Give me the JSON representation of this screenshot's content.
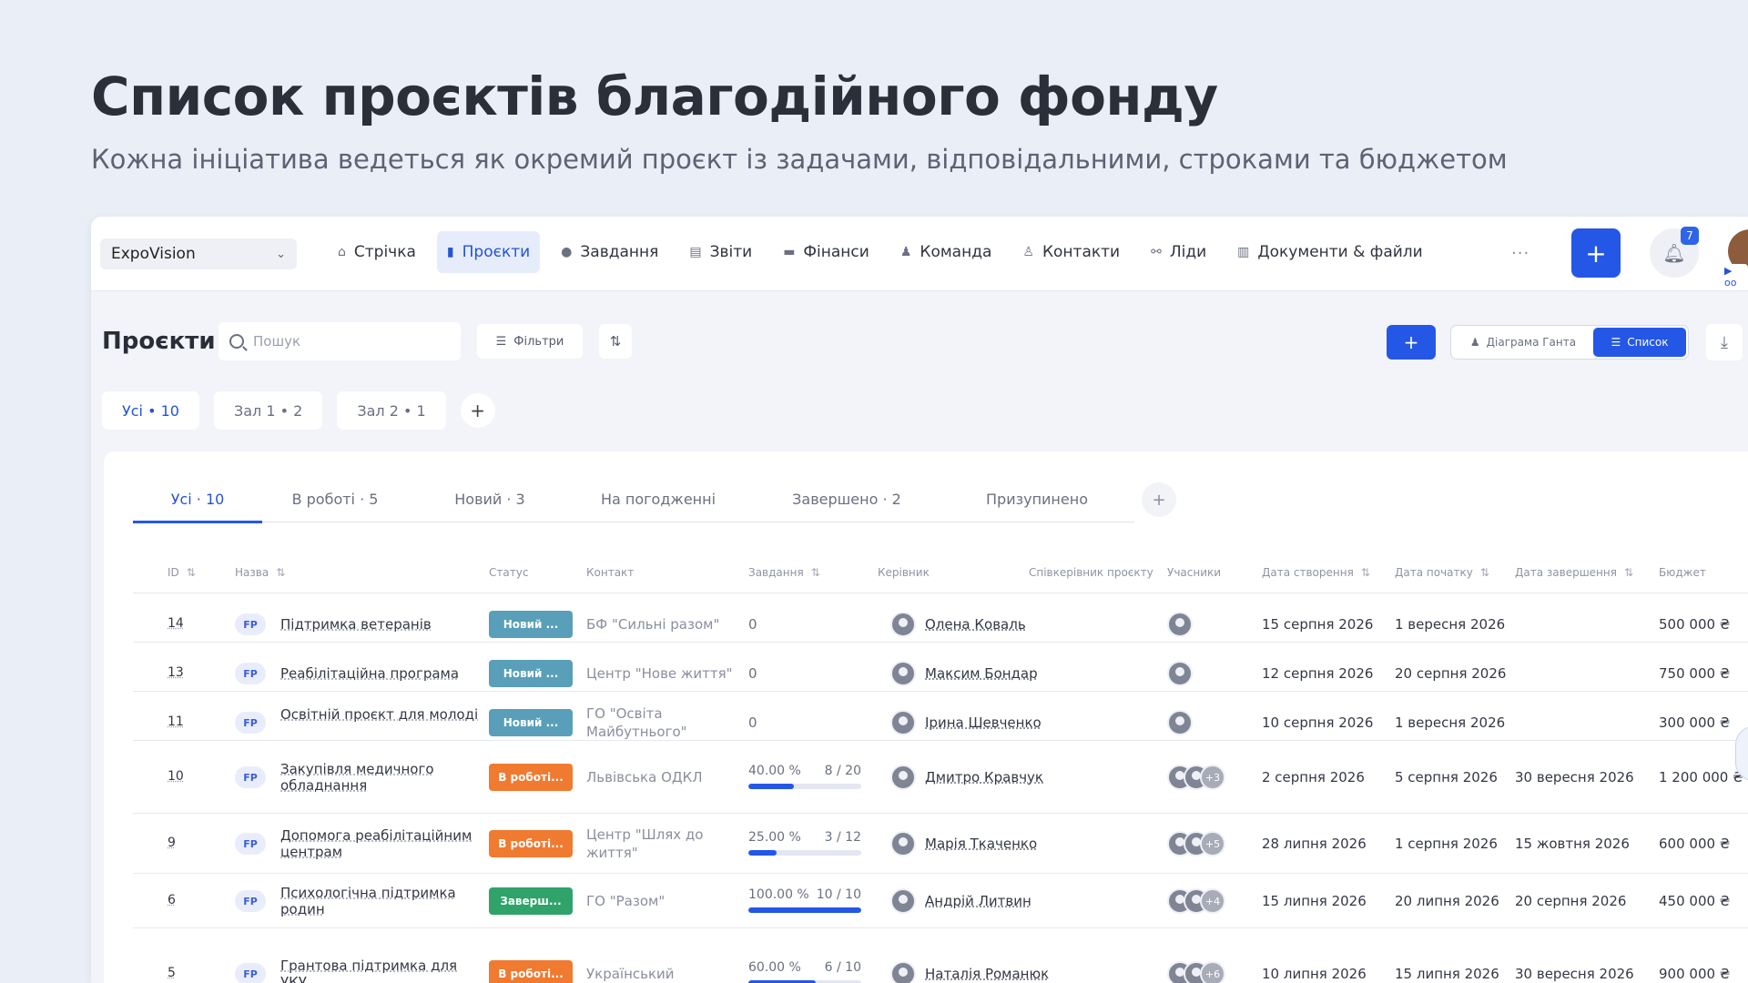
{
  "hero": {
    "title": "Список проєктів благодійного фонду",
    "subtitle": "Кожна ініціатива ведеться як окремий проєкт із задачами, відповідальними, строками та бюджетом"
  },
  "topnav": {
    "org": "ExpoVision",
    "items": [
      {
        "label": "Стрічка",
        "icon": "home-icon"
      },
      {
        "label": "Проєкти",
        "icon": "file-icon",
        "active": true
      },
      {
        "label": "Завдання",
        "icon": "check-circle-icon"
      },
      {
        "label": "Звіти",
        "icon": "report-icon"
      },
      {
        "label": "Фінанси",
        "icon": "wallet-icon"
      },
      {
        "label": "Команда",
        "icon": "user-icon"
      },
      {
        "label": "Контакти",
        "icon": "contacts-icon"
      },
      {
        "label": "Ліди",
        "icon": "leads-icon"
      },
      {
        "label": "Документи & файли",
        "icon": "book-icon"
      }
    ],
    "more": "···",
    "add": "+",
    "notifications": "7",
    "avatar_tag": "▶ oo"
  },
  "toolbar": {
    "title": "Проєкти",
    "search_placeholder": "Пошук",
    "filters": "Фільтри",
    "add": "+",
    "view_gantt": "Діаграма Ганта",
    "view_list": "Список"
  },
  "halls": [
    "Усі • 10",
    "Зал 1 • 2",
    "Зал 2 • 1"
  ],
  "status_tabs": [
    "Усі · 10",
    "В роботі · 5",
    "Новий · 3",
    "На погодженні",
    "Завершено · 2",
    "Призупинено"
  ],
  "table": {
    "headers": {
      "id": "ID",
      "name": "Назва",
      "status": "Статус",
      "contact": "Контакт",
      "tasks": "Завдання",
      "lead": "Керівник",
      "colead": "Співкерівник проєкту",
      "members": "Учасники",
      "created": "Дата створення",
      "start": "Дата початку",
      "end": "Дата завершення",
      "budget": "Бюджет"
    },
    "rows": [
      {
        "id": "14",
        "tag": "FP",
        "name": "Підтримка ветеранів",
        "status": "Новий ...",
        "contact": "БФ \"Сильні разом\"",
        "tasks": "0",
        "lead": "Олена Коваль",
        "created": "15 серпня 2026",
        "start": "1 вересня 2026",
        "end": "",
        "budget": "500 000 ₴"
      },
      {
        "id": "13",
        "tag": "FP",
        "name": "Реабілітаційна програма",
        "status": "Новий ...",
        "contact": "Центр \"Нове життя\"",
        "tasks": "0",
        "lead": "Максим Бондар",
        "created": "12 серпня 2026",
        "start": "20 серпня 2026",
        "end": "",
        "budget": "750 000 ₴"
      },
      {
        "id": "11",
        "tag": "FP",
        "name": "Освітній проєкт для молоді",
        "status": "Новий ...",
        "contact": "ГО \"Освіта Майбутнього\"",
        "tasks": "0",
        "lead": "Ірина Шевченко",
        "created": "10 серпня 2026",
        "start": "1 вересня 2026",
        "end": "",
        "budget": "300 000 ₴"
      },
      {
        "id": "10",
        "tag": "FP",
        "name": "Закупівля медичного обладнання",
        "status": "В роботі...",
        "contact": "Львівська ОДКЛ",
        "progress_pct": "40.00 %",
        "progress_count": "8 / 20",
        "progress": 0.4,
        "lead": "Дмитро Кравчук",
        "members_more": "+3",
        "created": "2 серпня 2026",
        "start": "5 серпня 2026",
        "end": "30 вересня 2026",
        "budget": "1 200 000 ₴"
      },
      {
        "id": "9",
        "tag": "FP",
        "name": "Допомога реабілітаційним центрам",
        "status": "В роботі...",
        "contact": "Центр \"Шлях до життя\"",
        "progress_pct": "25.00 %",
        "progress_count": "3 / 12",
        "progress": 0.25,
        "lead": "Марія Ткаченко",
        "members_more": "+5",
        "created": "28 липня 2026",
        "start": "1 серпня 2026",
        "end": "15 жовтня 2026",
        "budget": "600 000 ₴"
      },
      {
        "id": "6",
        "tag": "FP",
        "name": "Психологічна підтримка родин",
        "status": "Заверш...",
        "contact": "ГО \"Разом\"",
        "progress_pct": "100.00 %",
        "progress_count": "10 / 10",
        "progress": 1.0,
        "lead": "Андрій Литвин",
        "members_more": "+4",
        "created": "15 липня 2026",
        "start": "20 липня 2026",
        "end": "20 серпня 2026",
        "budget": "450 000 ₴"
      },
      {
        "id": "5",
        "tag": "FP",
        "name": "Грантова підтримка для УКУ",
        "status": "В роботі...",
        "contact": "Український",
        "progress_pct": "60.00 %",
        "progress_count": "6 / 10",
        "progress": 0.6,
        "lead": "Наталія Романюк",
        "members_more": "+6",
        "created": "10 липня 2026",
        "start": "15 липня 2026",
        "end": "30 вересня 2026",
        "budget": "900 000 ₴"
      }
    ]
  }
}
